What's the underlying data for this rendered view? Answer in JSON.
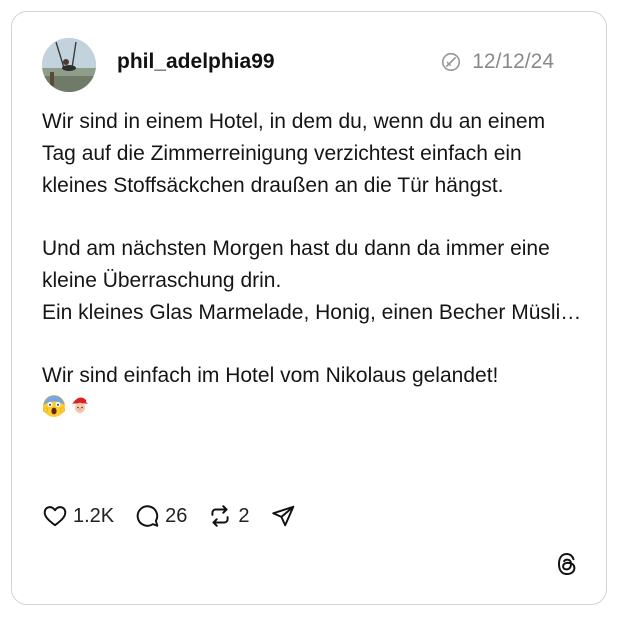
{
  "post": {
    "username": "phil_adelphia99",
    "date": "12/12/24",
    "paragraphs": [
      [
        "Wir sind in einem Hotel, in dem du, wenn du an einem Tag auf die Zimmerreinigung verzichtest einfach ein kleines Stoffsäckchen draußen an die Tür hängst."
      ],
      [
        "Und am nächsten Morgen hast du dann da immer eine kleine Überraschung drin.",
        "Ein kleines Glas Marmelade, Honig, einen Becher Müsli…"
      ],
      [
        "Wir sind einfach im Hotel vom Nikolaus gelandet!"
      ]
    ],
    "emoji_icons": [
      "face-screaming-in-fear-icon",
      "santa-claus-icon"
    ]
  },
  "actions": {
    "likes": "1.2K",
    "replies": "26",
    "reposts": "2",
    "like_icon": "heart-icon",
    "reply_icon": "speech-bubble-icon",
    "repost_icon": "repost-icon",
    "share_icon": "paper-plane-icon"
  },
  "colors": {
    "text": "#101010",
    "muted": "#8a8a8a",
    "border": "#d4d4d4"
  },
  "brand_icon": "threads-logo-icon"
}
